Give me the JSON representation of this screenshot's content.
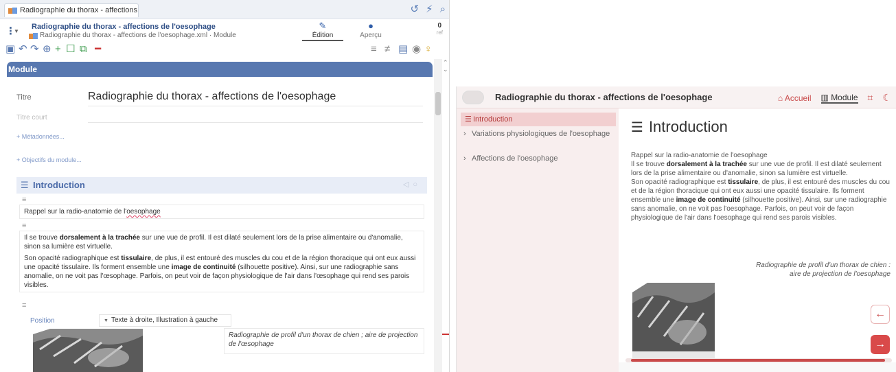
{
  "editor": {
    "tab_title": "Radiographie du thorax - affections ...",
    "tabstrip_icons": [
      "history-icon",
      "lightning-icon",
      "search-icon"
    ],
    "doc_title": "Radiographie du thorax - affections de l'oesophage",
    "doc_path": "Radiographie du thorax - affections de l'oesophage.xml · Module",
    "mode_edit": "Édition",
    "mode_preview": "Aperçu",
    "counter": "0",
    "counter_sub": "ref",
    "module_header": "Module",
    "title_label": "Titre",
    "title_value": "Radiographie du thorax - affections de l'oesophage",
    "short_title_label": "Titre court",
    "metadata_link": "+ Métadonnées...",
    "objectives_link": "+ Objectifs du module...",
    "section_title": "Introduction",
    "para1": {
      "before": "Rappel sur la radio-anatomie de l'",
      "marked": "oesophage"
    },
    "para2": {
      "t1": "Il se trouve ",
      "b1": "dorsalement à la trachée",
      "t2": " sur une vue de profil. Il est dilaté seulement lors de la prise alimentaire ou d'anomalie, sinon sa lumière est virtuelle."
    },
    "para3": {
      "t1": "Son opacité radiographique est ",
      "b1": "tissulaire",
      "t2": ", de plus, il est entouré des muscles du cou et de la région thoracique qui ont eux aussi une opacité tissulaire. Ils forment ensemble une ",
      "b2": "image de continuité",
      "t3": " (silhouette positive). Ainsi, sur une radiographie sans anomalie, on ne voit pas l'œsophage. Parfois, on peut voir de façon physiologique de l'air dans l'œsophage qui rend ses parois visibles."
    },
    "position_label": "Position",
    "position_value": "Texte à droite, Illustration à gauche",
    "caption": "Radiographie de profil d'un thorax de chien ; aire de projection de l'œsophage"
  },
  "preview": {
    "title": "Radiographie du thorax - affections de l'oesophage",
    "nav_home": "Accueil",
    "nav_module": "Module",
    "sidebar": [
      {
        "label": "Introduction",
        "active": true
      },
      {
        "label": "Variations physiologiques de l'oesophage",
        "active": false
      },
      {
        "label": "Affections de l'oesophage",
        "active": false
      }
    ],
    "h1": "Introduction",
    "text": {
      "l1": "Rappel sur la radio-anatomie de l'oesophage",
      "l2a": "Il se trouve ",
      "l2b": "dorsalement à la trachée",
      "l2c": " sur une vue de profil. Il est dilaté seulement lors de la prise alimentaire ou d'anomalie, sinon sa lumière est virtuelle.",
      "l3a": "Son opacité radiographique est ",
      "l3b": "tissulaire",
      "l3c": ", de plus, il est entouré des muscles du cou et de la région thoracique qui ont eux aussi une opacité tissulaire. Ils forment ensemble une ",
      "l3d": "image de continuité",
      "l3e": " (silhouette positive). Ainsi, sur une radiographie sans anomalie, on ne voit pas l'oesophage. Parfois, on peut voir de façon physiologique de l'air dans l'oesophage qui rend ses parois visibles."
    },
    "figure_caption": "Radiographie de profil d'un thorax de chien : aire de projection de l'oesophage"
  },
  "colors": {
    "editor_accent": "#5878b0",
    "preview_accent": "#c94a4a",
    "preview_active_bg": "#f2cfd0"
  }
}
